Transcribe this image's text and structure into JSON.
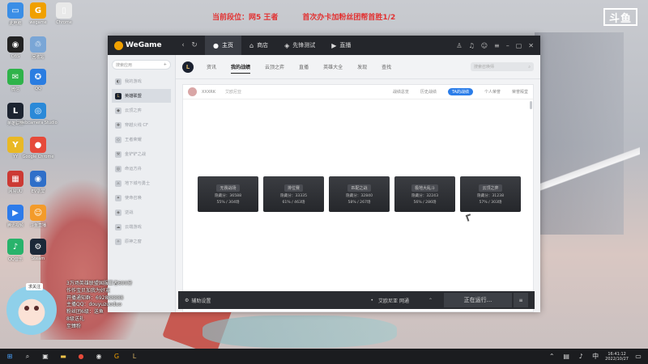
{
  "stream": {
    "rank_text": "当前段位：网5 王者",
    "goal_text": "首次办卡加粉丝团帮首胜1/2",
    "logo_text": "斗鱼"
  },
  "desktop_icons": [
    {
      "label": "此电脑",
      "glyph": "▭",
      "color": "#3a8ee6"
    },
    {
      "label": "wegame",
      "glyph": "G",
      "color": "#f0a000"
    },
    {
      "label": "Chrome",
      "glyph": "▯",
      "color": "#e9e9e9"
    },
    {
      "label": "OBS",
      "glyph": "◉",
      "color": "#222222"
    },
    {
      "label": "回收站",
      "glyph": "♲",
      "color": "#7aa6d6"
    },
    {
      "label": "微信",
      "glyph": "✉",
      "color": "#2fb34a"
    },
    {
      "label": "QQ",
      "glyph": "✪",
      "color": "#2a7de1"
    },
    {
      "label": "英雄联盟",
      "glyph": "L",
      "color": "#1c2330"
    },
    {
      "label": "Webcamera Studio",
      "glyph": "◎",
      "color": "#2a89d8"
    },
    {
      "label": "YY",
      "glyph": "Y",
      "color": "#e9b825"
    },
    {
      "label": "Google Chrome",
      "glyph": "●",
      "color": "#e64a3a"
    },
    {
      "label": "网易UU",
      "glyph": "▦",
      "color": "#cc3a34"
    },
    {
      "label": "EV录屏",
      "glyph": "◉",
      "color": "#2f6fc9"
    },
    {
      "label": "腾讯视频",
      "glyph": "▶",
      "color": "#2d7bea"
    },
    {
      "label": "斗鱼直播",
      "glyph": "☺",
      "color": "#f39b2a"
    },
    {
      "label": "QQ音乐",
      "glyph": "♪",
      "color": "#28b36b"
    },
    {
      "label": "Steam",
      "glyph": "⚙",
      "color": "#1b2838"
    }
  ],
  "wegame": {
    "logo": "WeGame",
    "tabs": [
      {
        "label": "主页",
        "icon": "●"
      },
      {
        "label": "商店",
        "icon": "⌂"
      },
      {
        "label": "先锋测试",
        "icon": "◈"
      },
      {
        "label": "直播",
        "icon": "▶"
      }
    ],
    "sidebar": {
      "search_placeholder": "搜索应用",
      "items": [
        {
          "label": "我的游戏",
          "icon": "◐"
        },
        {
          "label": "英雄联盟",
          "icon": "L"
        },
        {
          "label": "云顶之弈",
          "icon": "◆"
        },
        {
          "label": "穿越火线 CF",
          "icon": "✚"
        },
        {
          "label": "王者荣耀",
          "icon": "◇"
        },
        {
          "label": "金铲铲之战",
          "icon": "⚒"
        },
        {
          "label": "命运方舟",
          "icon": "◎"
        },
        {
          "label": "地下城与勇士",
          "icon": "⚔"
        },
        {
          "label": "使命召唤",
          "icon": "✦"
        },
        {
          "label": "逆战",
          "icon": "◈"
        },
        {
          "label": "云端游戏",
          "icon": "☁"
        },
        {
          "label": "原神之窗",
          "icon": "✧"
        }
      ]
    },
    "game_nav": {
      "tabs": [
        "资讯",
        "我的战绩",
        "云顶之弈",
        "直播",
        "英雄大全",
        "发现",
        "查找"
      ],
      "search_placeholder": "搜索召唤师"
    },
    "record": {
      "player_name": "XXXRK",
      "player_sub": "艾欧尼亚",
      "tabs": [
        "战绩总览",
        "历史战绩",
        "TA的战绩",
        "个人荣誉",
        "荣誉殿堂"
      ]
    },
    "cards": [
      {
        "name": "无畏战场",
        "score": "隐藏分：36588",
        "winrate": "55% / 304场"
      },
      {
        "name": "排位赛",
        "score": "隐藏分：33335",
        "winrate": "61% / 463场"
      },
      {
        "name": "匹配之战",
        "score": "隐藏分：32840",
        "winrate": "58% / 267场"
      },
      {
        "name": "极地大乱斗",
        "score": "隐藏分：32243",
        "winrate": "56% / 286场"
      },
      {
        "name": "云顶之弈",
        "score": "隐藏分：31238",
        "winrate": "57% / 303场"
      }
    ],
    "bottom": {
      "assist_label": "辅助设置",
      "region_label": "艾欧尼亚 网通",
      "run_label": "正在运行..."
    }
  },
  "overlay": {
    "tag": "求关注",
    "lines": [
      "3万场英雄联盟国服王者600分",
      "作作宝贝加我为好友",
      "开播通知群：692888888",
      "主播QQ：douyuzuoduo",
      "粉丝团6级：送鱼",
      "8级送礼",
      "至臻粉"
    ]
  },
  "taskbar": {
    "time": "16:41:12",
    "date": "2022/10/27"
  }
}
